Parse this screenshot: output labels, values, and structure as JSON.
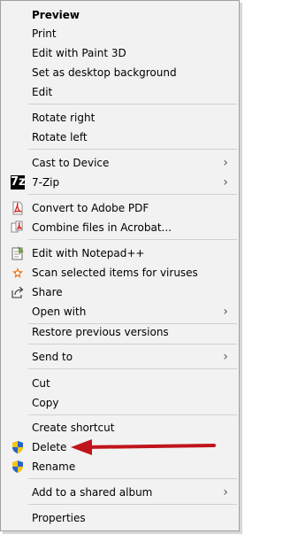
{
  "menu": {
    "items": [
      {
        "label": "Preview",
        "bold": true
      },
      {
        "label": "Print"
      },
      {
        "label": "Edit with Paint 3D"
      },
      {
        "label": "Set as desktop background"
      },
      {
        "label": "Edit"
      },
      {
        "label": "Rotate right"
      },
      {
        "label": "Rotate left"
      },
      {
        "label": "Cast to Device"
      },
      {
        "label": "7-Zip",
        "icon": "7-zip-icon",
        "icon_text": "7z"
      },
      {
        "label": "Convert to Adobe PDF",
        "icon": "adobe-pdf-icon"
      },
      {
        "label": "Combine files in Acrobat...",
        "icon": "acrobat-combine-icon"
      },
      {
        "label": "Edit with Notepad++",
        "icon": "notepad-plus-plus-icon"
      },
      {
        "label": "Scan selected items for viruses",
        "icon": "avast-icon"
      },
      {
        "label": "Share",
        "icon": "share-icon"
      },
      {
        "label": "Open with"
      },
      {
        "label": "Restore previous versions"
      },
      {
        "label": "Send to"
      },
      {
        "label": "Cut"
      },
      {
        "label": "Copy"
      },
      {
        "label": "Create shortcut"
      },
      {
        "label": "Delete",
        "icon": "uac-shield-icon"
      },
      {
        "label": "Rename",
        "icon": "uac-shield-icon"
      },
      {
        "label": "Add to a shared album"
      },
      {
        "label": "Properties"
      }
    ]
  },
  "colors": {
    "menu_background": "#f2f2f2",
    "separator": "#d0d0d0",
    "annotation_arrow": "#c0141c",
    "pdf_red": "#d4201e",
    "avast_orange": "#f47a20",
    "shield_blue": "#2a64c8",
    "shield_yellow": "#f5c518"
  },
  "annotation": {
    "type": "arrow",
    "points_to": "Delete"
  }
}
